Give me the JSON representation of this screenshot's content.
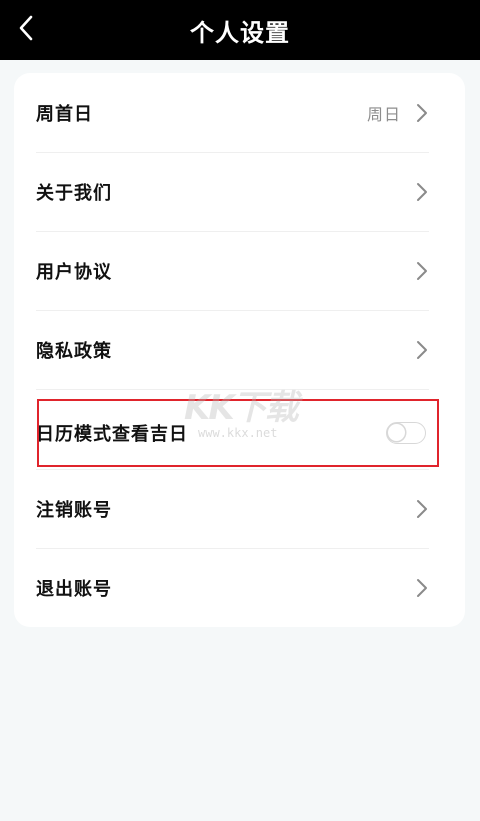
{
  "header": {
    "title": "个人设置",
    "back_icon": "chevron-left-icon"
  },
  "settings": {
    "week_start": {
      "label": "周首日",
      "value": "周日"
    },
    "about_us": {
      "label": "关于我们"
    },
    "user_agreement": {
      "label": "用户协议"
    },
    "privacy_policy": {
      "label": "隐私政策"
    },
    "calendar_mode": {
      "label": "日历模式查看吉日",
      "enabled": false
    },
    "cancel_account": {
      "label": "注销账号"
    },
    "logout": {
      "label": "退出账号"
    }
  },
  "watermark": {
    "logo": "KK下载",
    "url": "www.kkx.net"
  },
  "colors": {
    "header_bg": "#000000",
    "page_bg": "#f5f8f9",
    "highlight": "#e0242c",
    "chevron": "#8a8a8a"
  }
}
